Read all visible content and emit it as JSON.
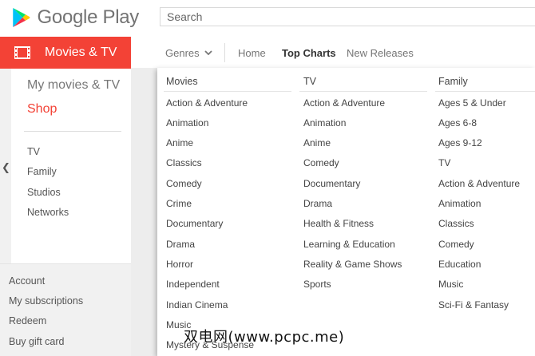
{
  "header": {
    "logo_text": "Google Play",
    "search_placeholder": "Search"
  },
  "category": {
    "label": "Movies & TV",
    "icon": "film-icon"
  },
  "nav": {
    "genres": "Genres",
    "home": "Home",
    "top_charts": "Top Charts",
    "new_releases": "New Releases"
  },
  "sidebar": {
    "my_movies": "My movies & TV",
    "shop": "Shop",
    "items": [
      "TV",
      "Family",
      "Studios",
      "Networks"
    ],
    "bottom": [
      "Account",
      "My subscriptions",
      "Redeem",
      "Buy gift card"
    ]
  },
  "dropdown": {
    "movies": {
      "heading": "Movies",
      "items": [
        "Action & Adventure",
        "Animation",
        "Anime",
        "Classics",
        "Comedy",
        "Crime",
        "Documentary",
        "Drama",
        "Horror",
        "Independent",
        "Indian Cinema",
        "Music",
        "Mystery & Suspense"
      ]
    },
    "tv": {
      "heading": "TV",
      "items": [
        "Action & Adventure",
        "Animation",
        "Anime",
        "Comedy",
        "Documentary",
        "Drama",
        "Health & Fitness",
        "Learning & Education",
        "Reality & Game Shows",
        "Sports"
      ]
    },
    "family": {
      "heading": "Family",
      "items": [
        "Ages 5 & Under",
        "Ages 6-8",
        "Ages 9-12",
        "TV",
        "Action & Adventure",
        "Animation",
        "Classics",
        "Comedy",
        "Education",
        "Music",
        "Sci-Fi & Fantasy"
      ]
    }
  },
  "watermark": "双电网(www.pcpc.me)",
  "colors": {
    "accent": "#f34236",
    "sidebar_bg": "#f1f1f1"
  }
}
